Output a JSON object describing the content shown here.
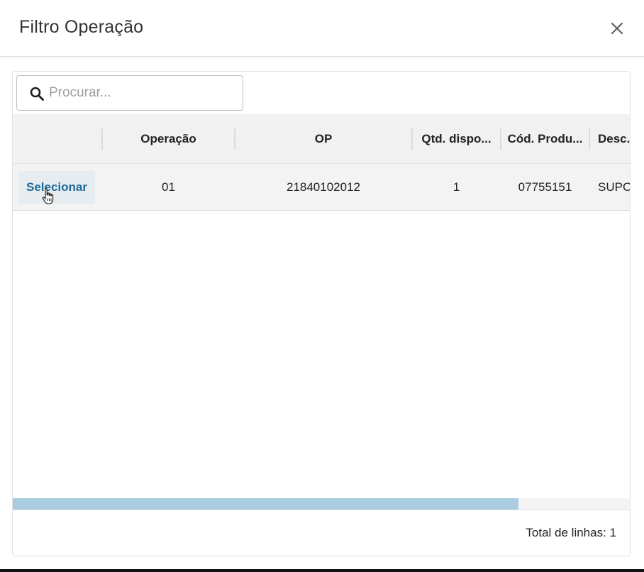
{
  "dialog": {
    "title": "Filtro Operação"
  },
  "search": {
    "placeholder": "Procurar...",
    "value": ""
  },
  "table": {
    "columns": [
      "",
      "Operação",
      "OP",
      "Qtd. dispo...",
      "Cód. Produ...",
      "Desc."
    ],
    "rows": [
      {
        "action": "Selecionar",
        "operacao": "01",
        "op": "21840102012",
        "qtd": "1",
        "cod": "07755151",
        "desc": "SUPO"
      }
    ]
  },
  "scrollbar": {
    "horizontal_position_fraction": 0.82
  },
  "footer": {
    "total_label": "Total de linhas: 1"
  },
  "colors": {
    "accent": "#1e6b99",
    "scroll_thumb": "#a9cce0",
    "header_bg": "#f1f1f1"
  },
  "icons": [
    "close-icon",
    "search-icon",
    "hand-cursor-icon"
  ]
}
